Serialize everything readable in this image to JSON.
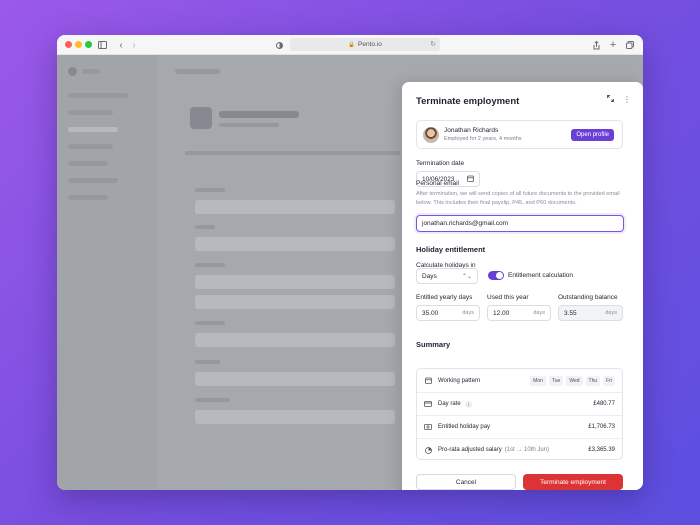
{
  "browser": {
    "url": "Pento.io",
    "colors": {
      "close": "#ff5f57",
      "minimize": "#febc2e",
      "maximize": "#28c840"
    }
  },
  "panel": {
    "title": "Terminate employment",
    "employee": {
      "name": "Jonathan Richards",
      "tenure": "Employed for 2 years, 4 months",
      "open_profile_label": "Open profile"
    },
    "termination_date": {
      "label": "Termination date",
      "value": "10/06/2023"
    },
    "personal_email": {
      "label": "Personal email",
      "description": "After termination, we will send copies of all future documents to the provided email below. This includes their final payslip, P45, and P60 documents.",
      "value": "jonathan.richards@gmail.com"
    },
    "holiday": {
      "title": "Holiday entitlement",
      "calc_label": "Calculate holidays in",
      "calc_value": "Days",
      "toggle_label": "Entitlement calculation",
      "toggle_on": true,
      "entitled": {
        "label": "Entitled yearly days",
        "value": "35.00",
        "unit": "days"
      },
      "used": {
        "label": "Used this year",
        "value": "12.00",
        "unit": "days"
      },
      "outstanding": {
        "label": "Outstanding balance",
        "value": "3.55",
        "unit": "days"
      }
    },
    "summary": {
      "title": "Summary",
      "working_pattern": {
        "label": "Working pattern",
        "days": [
          "Mon",
          "Tue",
          "Wed",
          "Thu",
          "Fri"
        ]
      },
      "day_rate": {
        "label": "Day rate",
        "value": "£480.77"
      },
      "holiday_pay": {
        "label": "Entitled holiday pay",
        "value": "£1,706.73"
      },
      "salary": {
        "label": "Pro-rata adjusted salary",
        "note": "(1st → 10th Jun)",
        "value": "£3,365.39"
      }
    },
    "cancel_label": "Cancel",
    "confirm_label": "Terminate employment"
  },
  "colors": {
    "accent": "#6a3fd8",
    "danger": "#dc3434"
  }
}
